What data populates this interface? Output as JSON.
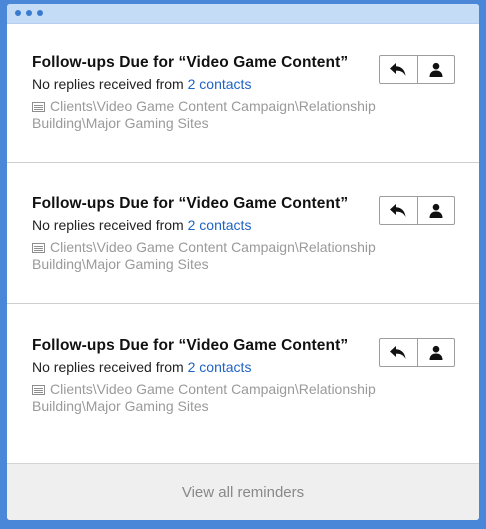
{
  "reminders": [
    {
      "title": "Follow-ups Due  for “Video Game Content”",
      "summary_prefix": "No replies received from ",
      "contacts_link": "2 contacts",
      "path": "Clients\\Video Game Content Campaign\\Relationship Building\\Major Gaming Sites"
    },
    {
      "title": "Follow-ups Due  for “Video Game Content”",
      "summary_prefix": "No replies received from ",
      "contacts_link": "2 contacts",
      "path": "Clients\\Video Game Content Campaign\\Relationship Building\\Major Gaming Sites"
    },
    {
      "title": "Follow-ups Due  for “Video Game Content”",
      "summary_prefix": "No replies received from ",
      "contacts_link": "2 contacts",
      "path": "Clients\\Video Game Content Campaign\\Relationship Building\\Major Gaming Sites"
    }
  ],
  "footer": {
    "view_all_label": "View all reminders"
  },
  "icons": {
    "reply": "reply-icon",
    "contact": "user-icon",
    "path": "folder-list-icon"
  },
  "colors": {
    "background": "#4a87d9",
    "titlebar": "#c5dcf7",
    "link": "#1f63c2",
    "muted": "#9a9a9a"
  }
}
